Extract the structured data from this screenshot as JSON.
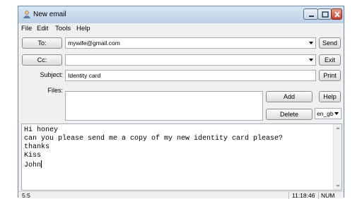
{
  "window": {
    "title": "New email"
  },
  "menu": [
    "File",
    "Edit",
    "Tools",
    "Help"
  ],
  "to": {
    "label": "To:",
    "value": "mywife@gmail.com"
  },
  "cc": {
    "label": "Cc:",
    "value": ""
  },
  "subject": {
    "label": "Subject:",
    "value": "Identity card"
  },
  "files": {
    "label": "Files:"
  },
  "buttons": {
    "send": "Send",
    "exit": "Exit",
    "print": "Print",
    "help": "Help",
    "add": "Add",
    "delete": "Delete"
  },
  "language": {
    "value": "en_gb"
  },
  "body": {
    "lines": [
      "Hi honey",
      "can you please send me a copy of my new identity card please?",
      "thanks",
      "Kiss",
      "John"
    ]
  },
  "status": {
    "position": "5:5",
    "time": "11:18:46",
    "num": "NUM"
  },
  "icons": {
    "app": "email-app-icon",
    "minimize": "minimize-icon",
    "maximize": "maximize-icon",
    "close": "close-icon"
  }
}
